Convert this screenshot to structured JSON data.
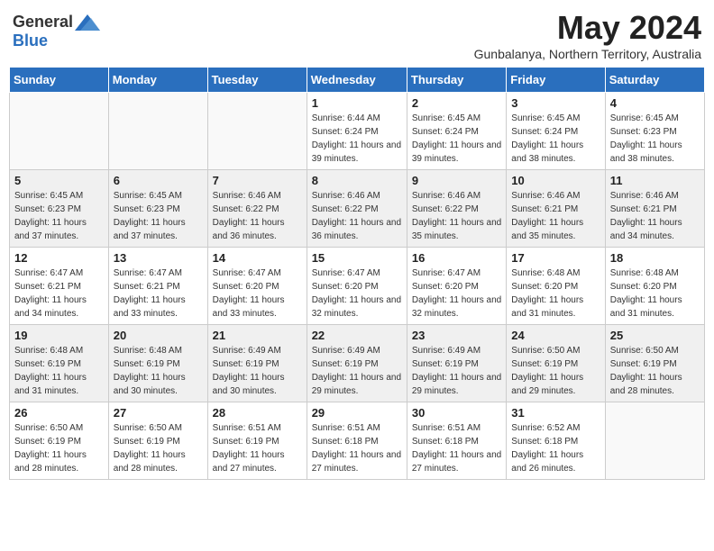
{
  "header": {
    "logo_general": "General",
    "logo_blue": "Blue",
    "month": "May 2024",
    "subtitle": "Gunbalanya, Northern Territory, Australia"
  },
  "weekdays": [
    "Sunday",
    "Monday",
    "Tuesday",
    "Wednesday",
    "Thursday",
    "Friday",
    "Saturday"
  ],
  "weeks": [
    [
      {
        "day": "",
        "sunrise": "",
        "sunset": "",
        "daylight": ""
      },
      {
        "day": "",
        "sunrise": "",
        "sunset": "",
        "daylight": ""
      },
      {
        "day": "",
        "sunrise": "",
        "sunset": "",
        "daylight": ""
      },
      {
        "day": "1",
        "sunrise": "Sunrise: 6:44 AM",
        "sunset": "Sunset: 6:24 PM",
        "daylight": "Daylight: 11 hours and 39 minutes."
      },
      {
        "day": "2",
        "sunrise": "Sunrise: 6:45 AM",
        "sunset": "Sunset: 6:24 PM",
        "daylight": "Daylight: 11 hours and 39 minutes."
      },
      {
        "day": "3",
        "sunrise": "Sunrise: 6:45 AM",
        "sunset": "Sunset: 6:24 PM",
        "daylight": "Daylight: 11 hours and 38 minutes."
      },
      {
        "day": "4",
        "sunrise": "Sunrise: 6:45 AM",
        "sunset": "Sunset: 6:23 PM",
        "daylight": "Daylight: 11 hours and 38 minutes."
      }
    ],
    [
      {
        "day": "5",
        "sunrise": "Sunrise: 6:45 AM",
        "sunset": "Sunset: 6:23 PM",
        "daylight": "Daylight: 11 hours and 37 minutes."
      },
      {
        "day": "6",
        "sunrise": "Sunrise: 6:45 AM",
        "sunset": "Sunset: 6:23 PM",
        "daylight": "Daylight: 11 hours and 37 minutes."
      },
      {
        "day": "7",
        "sunrise": "Sunrise: 6:46 AM",
        "sunset": "Sunset: 6:22 PM",
        "daylight": "Daylight: 11 hours and 36 minutes."
      },
      {
        "day": "8",
        "sunrise": "Sunrise: 6:46 AM",
        "sunset": "Sunset: 6:22 PM",
        "daylight": "Daylight: 11 hours and 36 minutes."
      },
      {
        "day": "9",
        "sunrise": "Sunrise: 6:46 AM",
        "sunset": "Sunset: 6:22 PM",
        "daylight": "Daylight: 11 hours and 35 minutes."
      },
      {
        "day": "10",
        "sunrise": "Sunrise: 6:46 AM",
        "sunset": "Sunset: 6:21 PM",
        "daylight": "Daylight: 11 hours and 35 minutes."
      },
      {
        "day": "11",
        "sunrise": "Sunrise: 6:46 AM",
        "sunset": "Sunset: 6:21 PM",
        "daylight": "Daylight: 11 hours and 34 minutes."
      }
    ],
    [
      {
        "day": "12",
        "sunrise": "Sunrise: 6:47 AM",
        "sunset": "Sunset: 6:21 PM",
        "daylight": "Daylight: 11 hours and 34 minutes."
      },
      {
        "day": "13",
        "sunrise": "Sunrise: 6:47 AM",
        "sunset": "Sunset: 6:21 PM",
        "daylight": "Daylight: 11 hours and 33 minutes."
      },
      {
        "day": "14",
        "sunrise": "Sunrise: 6:47 AM",
        "sunset": "Sunset: 6:20 PM",
        "daylight": "Daylight: 11 hours and 33 minutes."
      },
      {
        "day": "15",
        "sunrise": "Sunrise: 6:47 AM",
        "sunset": "Sunset: 6:20 PM",
        "daylight": "Daylight: 11 hours and 32 minutes."
      },
      {
        "day": "16",
        "sunrise": "Sunrise: 6:47 AM",
        "sunset": "Sunset: 6:20 PM",
        "daylight": "Daylight: 11 hours and 32 minutes."
      },
      {
        "day": "17",
        "sunrise": "Sunrise: 6:48 AM",
        "sunset": "Sunset: 6:20 PM",
        "daylight": "Daylight: 11 hours and 31 minutes."
      },
      {
        "day": "18",
        "sunrise": "Sunrise: 6:48 AM",
        "sunset": "Sunset: 6:20 PM",
        "daylight": "Daylight: 11 hours and 31 minutes."
      }
    ],
    [
      {
        "day": "19",
        "sunrise": "Sunrise: 6:48 AM",
        "sunset": "Sunset: 6:19 PM",
        "daylight": "Daylight: 11 hours and 31 minutes."
      },
      {
        "day": "20",
        "sunrise": "Sunrise: 6:48 AM",
        "sunset": "Sunset: 6:19 PM",
        "daylight": "Daylight: 11 hours and 30 minutes."
      },
      {
        "day": "21",
        "sunrise": "Sunrise: 6:49 AM",
        "sunset": "Sunset: 6:19 PM",
        "daylight": "Daylight: 11 hours and 30 minutes."
      },
      {
        "day": "22",
        "sunrise": "Sunrise: 6:49 AM",
        "sunset": "Sunset: 6:19 PM",
        "daylight": "Daylight: 11 hours and 29 minutes."
      },
      {
        "day": "23",
        "sunrise": "Sunrise: 6:49 AM",
        "sunset": "Sunset: 6:19 PM",
        "daylight": "Daylight: 11 hours and 29 minutes."
      },
      {
        "day": "24",
        "sunrise": "Sunrise: 6:50 AM",
        "sunset": "Sunset: 6:19 PM",
        "daylight": "Daylight: 11 hours and 29 minutes."
      },
      {
        "day": "25",
        "sunrise": "Sunrise: 6:50 AM",
        "sunset": "Sunset: 6:19 PM",
        "daylight": "Daylight: 11 hours and 28 minutes."
      }
    ],
    [
      {
        "day": "26",
        "sunrise": "Sunrise: 6:50 AM",
        "sunset": "Sunset: 6:19 PM",
        "daylight": "Daylight: 11 hours and 28 minutes."
      },
      {
        "day": "27",
        "sunrise": "Sunrise: 6:50 AM",
        "sunset": "Sunset: 6:19 PM",
        "daylight": "Daylight: 11 hours and 28 minutes."
      },
      {
        "day": "28",
        "sunrise": "Sunrise: 6:51 AM",
        "sunset": "Sunset: 6:19 PM",
        "daylight": "Daylight: 11 hours and 27 minutes."
      },
      {
        "day": "29",
        "sunrise": "Sunrise: 6:51 AM",
        "sunset": "Sunset: 6:18 PM",
        "daylight": "Daylight: 11 hours and 27 minutes."
      },
      {
        "day": "30",
        "sunrise": "Sunrise: 6:51 AM",
        "sunset": "Sunset: 6:18 PM",
        "daylight": "Daylight: 11 hours and 27 minutes."
      },
      {
        "day": "31",
        "sunrise": "Sunrise: 6:52 AM",
        "sunset": "Sunset: 6:18 PM",
        "daylight": "Daylight: 11 hours and 26 minutes."
      },
      {
        "day": "",
        "sunrise": "",
        "sunset": "",
        "daylight": ""
      }
    ]
  ]
}
